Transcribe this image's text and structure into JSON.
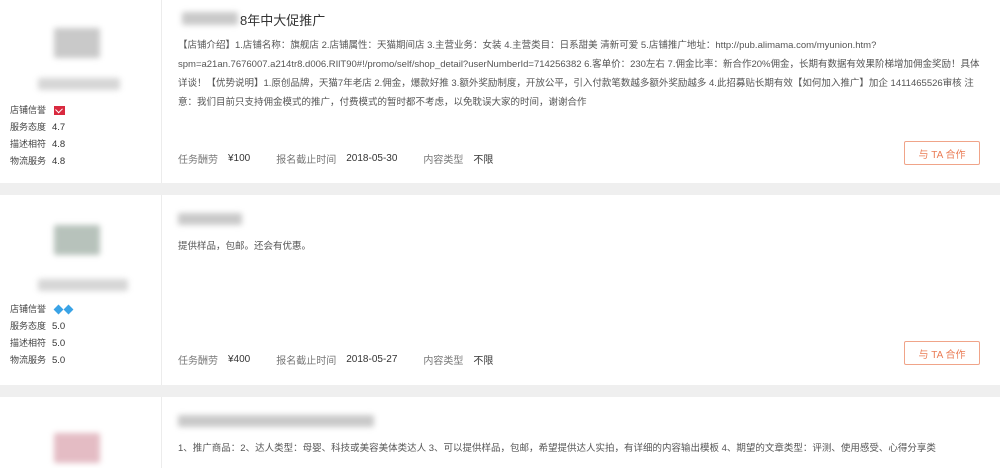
{
  "cards": [
    {
      "title": "8年中大促推广",
      "description": "【店铺介绍】1.店铺名称：旗舰店 2.店铺属性：天猫期间店 3.主营业务：女装 4.主营类目：日系甜美 清新可爱 5.店铺推广地址：http://pub.alimama.com/myunion.htm?spm=a21an.7676007.a214tr8.d006.RIlT90#!/promo/self/shop_detail?userNumberId=714256382 6.客单价：230左右 7.佣金比率：新合作20%佣金，长期有数据有效果阶梯增加佣金奖励！具体详谈！【优势说明】1.原创品牌，天猫7年老店 2.佣金，爆款好推 3.额外奖励制度，开放公平，引入付款笔数越多额外奖励越多 4.此招募贴长期有效【如何加入推广】加企 1411465526审核 注意：我们目前只支持佣金模式的推广，付费模式的暂时都不考虑，以免耽误大家的时间，谢谢合作",
      "reward_label": "任务酬劳",
      "reward": "¥100",
      "deadline_label": "报名截止时间",
      "deadline": "2018-05-30",
      "content_type_label": "内容类型",
      "content_type": "不限",
      "button": "与 TA 合作",
      "stats": [
        {
          "label": "店铺信誉",
          "value": ""
        },
        {
          "label": "服务态度",
          "value": "4.7"
        },
        {
          "label": "描述相符",
          "value": "4.8"
        },
        {
          "label": "物流服务",
          "value": "4.8"
        }
      ]
    },
    {
      "title": "",
      "description": "提供样品，包邮。还会有优惠。",
      "reward_label": "任务酬劳",
      "reward": "¥400",
      "deadline_label": "报名截止时间",
      "deadline": "2018-05-27",
      "content_type_label": "内容类型",
      "content_type": "不限",
      "button": "与 TA 合作",
      "stats": [
        {
          "label": "店铺信誉",
          "value": ""
        },
        {
          "label": "服务态度",
          "value": "5.0"
        },
        {
          "label": "描述相符",
          "value": "5.0"
        },
        {
          "label": "物流服务",
          "value": "5.0"
        }
      ]
    },
    {
      "description": "1、推广商品：2、达人类型：母婴、科技或美容美体类达人 3、可以提供样品，包邮，希望提供达人实拍，有详细的内容输出模板 4、期望的文章类型：评测、使用感受、心得分享类"
    }
  ],
  "colors": {
    "accent": "#ea7c55",
    "credit_red": "#d9293f",
    "credit_blue": "#3aa3e6"
  }
}
